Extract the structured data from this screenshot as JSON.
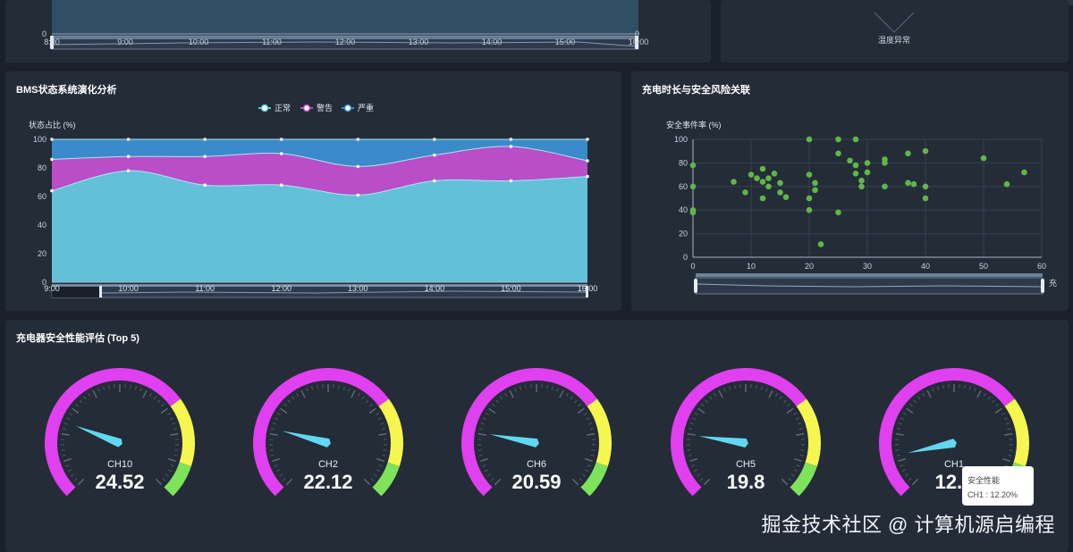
{
  "header": {
    "title": ""
  },
  "top_left_panel": {
    "y_min_left": "0",
    "y_min_right": "0",
    "x_ticks": [
      "8:00",
      "9:00",
      "10:00",
      "11:00",
      "12:00",
      "13:00",
      "14:00",
      "15:00",
      "16:00"
    ]
  },
  "top_right_panel": {
    "label": "温度异常"
  },
  "bms_panel": {
    "title": "BMS状态系统演化分析"
  },
  "scatter_panel": {
    "title": "充电时长与安全风险关联"
  },
  "gauge_panel": {
    "title": "充电器安全性能评估 (Top 5)"
  },
  "tooltip": {
    "title": "安全性能",
    "body": "CH1 : 12.20%"
  },
  "watermark": "掘金技术社区 @ 计算机源启编程",
  "colors": {
    "normal": "#5ec6d9",
    "warning": "#c04bc8",
    "severe": "#3d8fd1",
    "scatter": "#62b548",
    "gauge_magenta": "#e040f0",
    "gauge_yellow": "#f6f651",
    "gauge_green": "#7ee35a",
    "needle": "#60d8f0"
  },
  "chart_data": [
    {
      "type": "area",
      "title": "",
      "legend": [
        "正常",
        "警告",
        "严重"
      ],
      "legend_position": "top-center",
      "ylabel": "状态占比 (%)",
      "ylim": [
        0,
        100
      ],
      "y_ticks": [
        "0",
        "20",
        "40",
        "60",
        "80",
        "100"
      ],
      "categories": [
        "9:00",
        "10:00",
        "11:00",
        "12:00",
        "13:00",
        "14:00",
        "15:00",
        "16:00"
      ],
      "x_ticks": [
        "9:00",
        "10:00",
        "11:00",
        "12:00",
        "13:00",
        "14:00",
        "15:00",
        "16:00"
      ],
      "stacked": true,
      "grid": false,
      "series": [
        {
          "name": "正常",
          "values": [
            64,
            78,
            68,
            68,
            61,
            71,
            71,
            74
          ]
        },
        {
          "name": "警告",
          "values": [
            22,
            10,
            20,
            22,
            20,
            18,
            24,
            11
          ]
        },
        {
          "name": "严重",
          "values": [
            14,
            12,
            12,
            10,
            19,
            11,
            5,
            15
          ]
        }
      ]
    },
    {
      "type": "scatter",
      "title": "",
      "ylabel": "安全事件率 (%)",
      "xlabel": "充",
      "xlim": [
        0,
        60
      ],
      "ylim": [
        0,
        100
      ],
      "x_ticks": [
        "0",
        "10",
        "20",
        "30",
        "40",
        "50",
        "60"
      ],
      "y_ticks": [
        "0",
        "20",
        "40",
        "60",
        "80",
        "100"
      ],
      "grid": true,
      "points": [
        [
          0,
          78
        ],
        [
          0,
          60
        ],
        [
          0,
          40
        ],
        [
          0,
          38
        ],
        [
          7,
          64
        ],
        [
          9,
          55
        ],
        [
          10,
          70
        ],
        [
          11,
          67
        ],
        [
          12,
          75
        ],
        [
          12,
          64
        ],
        [
          12,
          50
        ],
        [
          13,
          60
        ],
        [
          13,
          67
        ],
        [
          14,
          71
        ],
        [
          15,
          55
        ],
        [
          15,
          63
        ],
        [
          16,
          51
        ],
        [
          20,
          100
        ],
        [
          20,
          70
        ],
        [
          20,
          50
        ],
        [
          20,
          40
        ],
        [
          21,
          63
        ],
        [
          21,
          57
        ],
        [
          22,
          11
        ],
        [
          25,
          100
        ],
        [
          25,
          88
        ],
        [
          25,
          38
        ],
        [
          27,
          82
        ],
        [
          28,
          100
        ],
        [
          28,
          78
        ],
        [
          28,
          71
        ],
        [
          29,
          65
        ],
        [
          29,
          60
        ],
        [
          30,
          80
        ],
        [
          30,
          72
        ],
        [
          33,
          83
        ],
        [
          33,
          80
        ],
        [
          33,
          60
        ],
        [
          37,
          88
        ],
        [
          37,
          63
        ],
        [
          38,
          62
        ],
        [
          40,
          90
        ],
        [
          40,
          60
        ],
        [
          40,
          50
        ],
        [
          50,
          84
        ],
        [
          54,
          62
        ],
        [
          57,
          72
        ]
      ]
    },
    {
      "type": "gauge",
      "title": "",
      "series_label": "安全性能",
      "gauges": [
        {
          "name": "CH10",
          "value": 24.52,
          "label": "24.52"
        },
        {
          "name": "CH2",
          "value": 22.12,
          "label": "22.12"
        },
        {
          "name": "CH6",
          "value": 20.59,
          "label": "20.59"
        },
        {
          "name": "CH5",
          "value": 19.8,
          "label": "19.8"
        },
        {
          "name": "CH1",
          "value": 12.2,
          "label": "12.2"
        }
      ]
    }
  ]
}
